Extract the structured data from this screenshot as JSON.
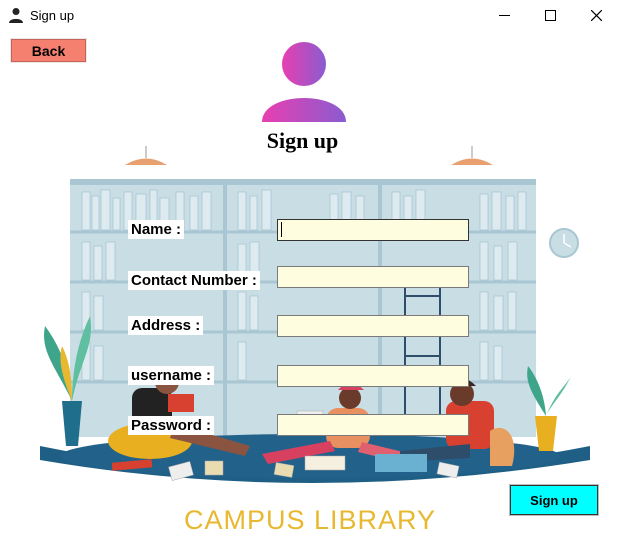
{
  "window": {
    "title": "Sign up",
    "icon": "user-icon",
    "controls": [
      "minimize-icon",
      "maximize-icon",
      "close-icon"
    ]
  },
  "toolbar": {
    "back_label": "Back"
  },
  "header": {
    "avatar_icon": "user-avatar-icon",
    "title": "Sign up"
  },
  "form": {
    "fields": [
      {
        "label": "Name :",
        "value": ""
      },
      {
        "label": "Contact Number :",
        "value": ""
      },
      {
        "label": "Address :",
        "value": ""
      },
      {
        "label": "username :",
        "value": ""
      },
      {
        "label": "Password :",
        "value": ""
      }
    ],
    "submit_label": "Sign up"
  },
  "footer": {
    "brand": "CAMPUS LIBRARY"
  },
  "colors": {
    "back_button": "#f58070",
    "submit_button": "#00ffff",
    "field_background": "#fffde0",
    "brand_text": "#e8b830",
    "avatar_gradient": [
      "#e83fb0",
      "#8a5cd0"
    ]
  }
}
